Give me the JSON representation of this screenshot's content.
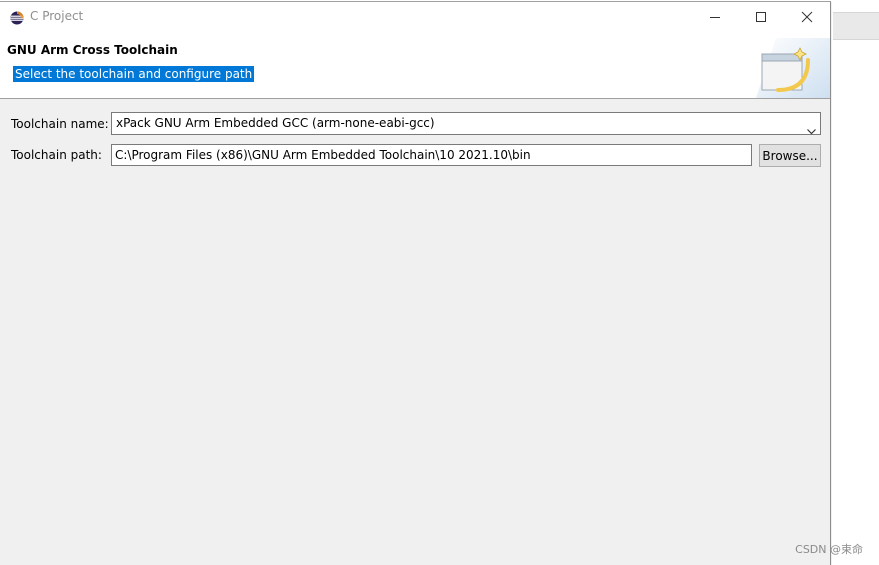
{
  "window": {
    "title": "C Project"
  },
  "header": {
    "title": "GNU Arm Cross Toolchain",
    "description": "Select the toolchain and configure path"
  },
  "form": {
    "toolchain_name_label": "Toolchain name:",
    "toolchain_name_value": "xPack GNU Arm Embedded GCC (arm-none-eabi-gcc)",
    "toolchain_path_label": "Toolchain path:",
    "toolchain_path_value": "C:\\Program Files (x86)\\GNU Arm Embedded Toolchain\\10 2021.10\\bin",
    "browse_label": "Browse..."
  },
  "watermark": "CSDN @束命",
  "icons": {
    "app": "eclipse-icon",
    "minimize": "minimize-icon",
    "maximize": "maximize-icon",
    "close": "close-icon",
    "dropdown": "chevron-down-icon",
    "wizard": "wizard-banner-icon"
  },
  "colors": {
    "selection": "#0078d7",
    "dialog_bg": "#f0f0f0",
    "header_bg": "#ffffff"
  }
}
